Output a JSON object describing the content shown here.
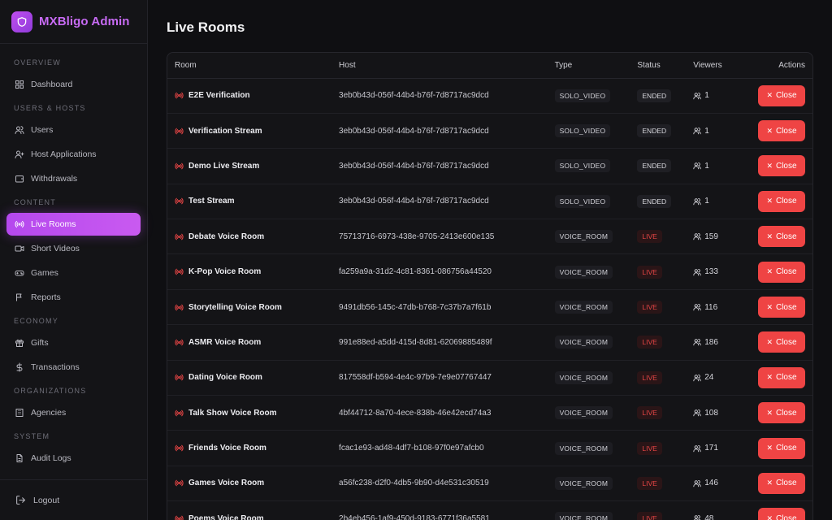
{
  "brand": {
    "title": "MXBligo Admin"
  },
  "sidebar": {
    "sections": [
      {
        "label": "OVERVIEW",
        "items": [
          {
            "label": "Dashboard",
            "icon": "grid-icon"
          }
        ]
      },
      {
        "label": "USERS & HOSTS",
        "items": [
          {
            "label": "Users",
            "icon": "users-icon"
          },
          {
            "label": "Host Applications",
            "icon": "user-plus-icon"
          },
          {
            "label": "Withdrawals",
            "icon": "wallet-icon"
          }
        ]
      },
      {
        "label": "CONTENT",
        "items": [
          {
            "label": "Live Rooms",
            "icon": "radio-icon",
            "active": true
          },
          {
            "label": "Short Videos",
            "icon": "video-icon"
          },
          {
            "label": "Games",
            "icon": "gamepad-icon"
          },
          {
            "label": "Reports",
            "icon": "flag-icon"
          }
        ]
      },
      {
        "label": "ECONOMY",
        "items": [
          {
            "label": "Gifts",
            "icon": "gift-icon"
          },
          {
            "label": "Transactions",
            "icon": "dollar-icon"
          }
        ]
      },
      {
        "label": "ORGANIZATIONS",
        "items": [
          {
            "label": "Agencies",
            "icon": "building-icon"
          }
        ]
      },
      {
        "label": "SYSTEM",
        "items": [
          {
            "label": "Audit Logs",
            "icon": "file-icon"
          }
        ]
      }
    ],
    "logout_label": "Logout"
  },
  "page": {
    "title": "Live Rooms"
  },
  "table": {
    "headers": {
      "room": "Room",
      "host": "Host",
      "type": "Type",
      "status": "Status",
      "viewers": "Viewers",
      "actions": "Actions"
    },
    "close_label": "Close",
    "rows": [
      {
        "room": "E2E Verification",
        "host": "3eb0b43d-056f-44b4-b76f-7d8717ac9dcd",
        "type": "SOLO_VIDEO",
        "status": "ENDED",
        "viewers": "1"
      },
      {
        "room": "Verification Stream",
        "host": "3eb0b43d-056f-44b4-b76f-7d8717ac9dcd",
        "type": "SOLO_VIDEO",
        "status": "ENDED",
        "viewers": "1"
      },
      {
        "room": "Demo Live Stream",
        "host": "3eb0b43d-056f-44b4-b76f-7d8717ac9dcd",
        "type": "SOLO_VIDEO",
        "status": "ENDED",
        "viewers": "1"
      },
      {
        "room": "Test Stream",
        "host": "3eb0b43d-056f-44b4-b76f-7d8717ac9dcd",
        "type": "SOLO_VIDEO",
        "status": "ENDED",
        "viewers": "1"
      },
      {
        "room": "Debate Voice Room",
        "host": "75713716-6973-438e-9705-2413e600e135",
        "type": "VOICE_ROOM",
        "status": "LIVE",
        "viewers": "159"
      },
      {
        "room": "K-Pop Voice Room",
        "host": "fa259a9a-31d2-4c81-8361-086756a44520",
        "type": "VOICE_ROOM",
        "status": "LIVE",
        "viewers": "133"
      },
      {
        "room": "Storytelling Voice Room",
        "host": "9491db56-145c-47db-b768-7c37b7a7f61b",
        "type": "VOICE_ROOM",
        "status": "LIVE",
        "viewers": "116"
      },
      {
        "room": "ASMR Voice Room",
        "host": "991e88ed-a5dd-415d-8d81-62069885489f",
        "type": "VOICE_ROOM",
        "status": "LIVE",
        "viewers": "186"
      },
      {
        "room": "Dating Voice Room",
        "host": "817558df-b594-4e4c-97b9-7e9e07767447",
        "type": "VOICE_ROOM",
        "status": "LIVE",
        "viewers": "24"
      },
      {
        "room": "Talk Show Voice Room",
        "host": "4bf44712-8a70-4ece-838b-46e42ecd74a3",
        "type": "VOICE_ROOM",
        "status": "LIVE",
        "viewers": "108"
      },
      {
        "room": "Friends Voice Room",
        "host": "fcac1e93-ad48-4df7-b108-97f0e97afcb0",
        "type": "VOICE_ROOM",
        "status": "LIVE",
        "viewers": "171"
      },
      {
        "room": "Games Voice Room",
        "host": "a56fc238-d2f0-4db5-9b90-d4e531c30519",
        "type": "VOICE_ROOM",
        "status": "LIVE",
        "viewers": "146"
      },
      {
        "room": "Poems Voice Room",
        "host": "2b4eb456-1af9-450d-9183-6771f36a5581",
        "type": "VOICE_ROOM",
        "status": "LIVE",
        "viewers": "48"
      }
    ]
  },
  "colors": {
    "accent": "#c95af0",
    "danger": "#ef4444",
    "live": "#e64545",
    "background": "#0f0f12",
    "sidebar": "#141417"
  }
}
